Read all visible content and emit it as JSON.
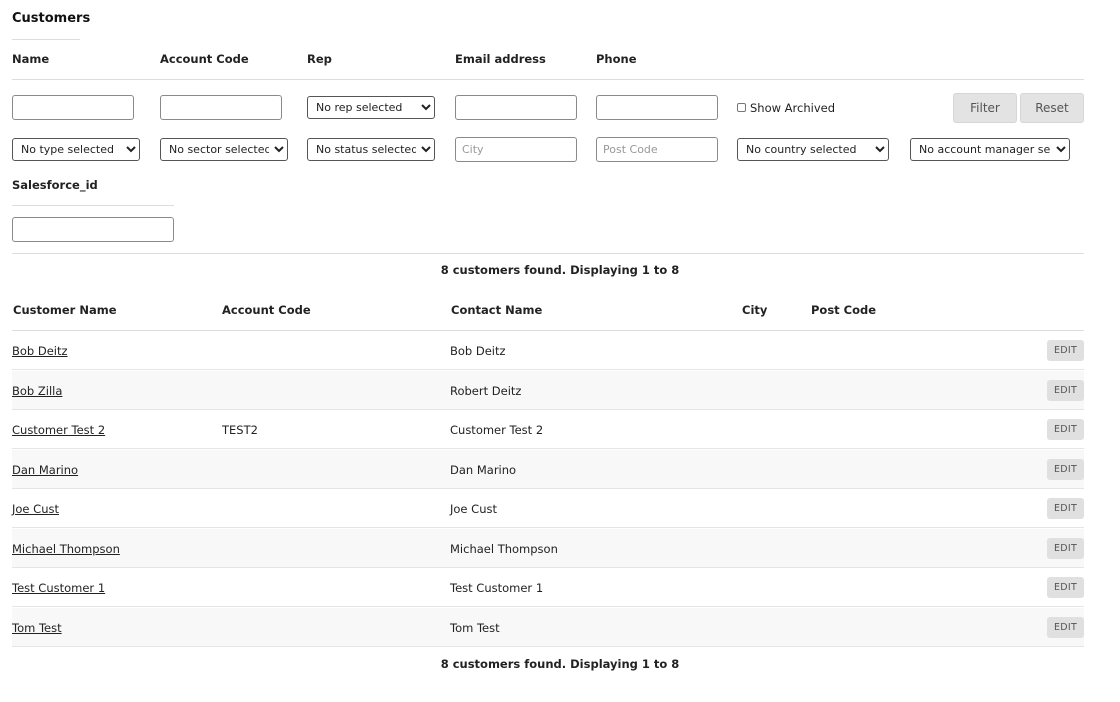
{
  "page": {
    "title": "Customers"
  },
  "filters": {
    "labels": {
      "name": "Name",
      "account_code": "Account Code",
      "rep": "Rep",
      "email": "Email address",
      "phone": "Phone",
      "salesforce": "Salesforce_id"
    },
    "values": {
      "name": "",
      "account_code": "",
      "email": "",
      "phone": "",
      "city": "",
      "post_code": "",
      "salesforce": ""
    },
    "placeholders": {
      "city": "City",
      "post_code": "Post Code"
    },
    "selects": {
      "rep": "No rep selected",
      "type": "No type selected",
      "sector": "No sector selected",
      "status": "No status selected",
      "country": "No country selected",
      "account_manager": "No account manager selected"
    },
    "show_archived_label": "Show Archived",
    "show_archived": false,
    "filter_button": "Filter",
    "reset_button": "Reset"
  },
  "summary": "8 customers found. Displaying 1 to 8",
  "table": {
    "headers": {
      "customer_name": "Customer Name",
      "account_code": "Account Code",
      "contact_name": "Contact Name",
      "city": "City",
      "post_code": "Post Code"
    },
    "edit_label": "EDIT",
    "rows": [
      {
        "customer_name": "Bob Deitz",
        "account_code": "",
        "contact_name": "Bob Deitz",
        "city": "",
        "post_code": ""
      },
      {
        "customer_name": "Bob Zilla",
        "account_code": "",
        "contact_name": "Robert Deitz",
        "city": "",
        "post_code": ""
      },
      {
        "customer_name": "Customer Test 2",
        "account_code": "TEST2",
        "contact_name": "Customer Test 2",
        "city": "",
        "post_code": ""
      },
      {
        "customer_name": "Dan Marino",
        "account_code": "",
        "contact_name": "Dan Marino",
        "city": "",
        "post_code": ""
      },
      {
        "customer_name": "Joe Cust",
        "account_code": "",
        "contact_name": "Joe Cust",
        "city": "",
        "post_code": ""
      },
      {
        "customer_name": "Michael Thompson",
        "account_code": "",
        "contact_name": "Michael Thompson",
        "city": "",
        "post_code": ""
      },
      {
        "customer_name": "Test Customer 1",
        "account_code": "",
        "contact_name": "Test Customer 1",
        "city": "",
        "post_code": ""
      },
      {
        "customer_name": "Tom Test",
        "account_code": "",
        "contact_name": "Tom Test",
        "city": "",
        "post_code": ""
      }
    ]
  }
}
